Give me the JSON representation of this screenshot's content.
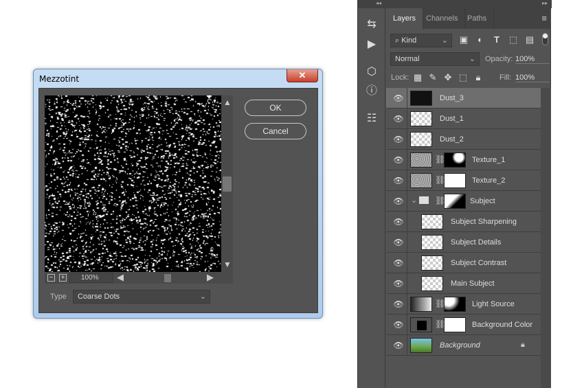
{
  "dialog": {
    "title": "Mezzotint",
    "close": "✕",
    "ok_label": "OK",
    "cancel_label": "Cancel",
    "zoom_level": "100%",
    "zoom_out": "−",
    "zoom_in": "+",
    "type_label": "Type",
    "type_value": "Coarse Dots"
  },
  "panel": {
    "collapse_left": "◂◂",
    "collapse_right": "▸▸",
    "tabs": [
      "Layers",
      "Channels",
      "Paths"
    ],
    "menu": "≡",
    "filter_kind": "Kind",
    "blend_mode": "Normal",
    "opacity_label": "Opacity:",
    "opacity_value": "100%",
    "lock_label": "Lock:",
    "fill_label": "Fill:",
    "fill_value": "100%"
  },
  "layers": [
    {
      "name": "Dust_3",
      "selected": true
    },
    {
      "name": "Dust_1"
    },
    {
      "name": "Dust_2"
    },
    {
      "name": "Texture_1"
    },
    {
      "name": "Texture_2"
    },
    {
      "name": "Subject"
    },
    {
      "name": "Subject Sharpening"
    },
    {
      "name": "Subject Details"
    },
    {
      "name": "Subject Contrast"
    },
    {
      "name": "Main Subject"
    },
    {
      "name": "Light Source"
    },
    {
      "name": "Background Color"
    },
    {
      "name": "Background"
    }
  ]
}
